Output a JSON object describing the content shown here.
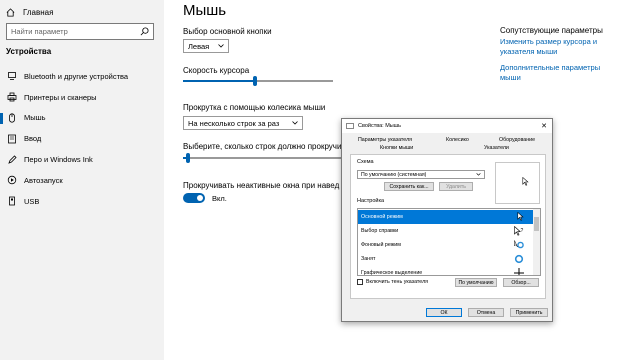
{
  "sidebar": {
    "home_label": "Главная",
    "search_placeholder": "Найти параметр",
    "section_label": "Устройства",
    "items": [
      {
        "label": "Bluetooth и другие устройства",
        "icon": "bluetooth-icon"
      },
      {
        "label": "Принтеры и сканеры",
        "icon": "printer-icon"
      },
      {
        "label": "Мышь",
        "icon": "mouse-icon",
        "active": true
      },
      {
        "label": "Ввод",
        "icon": "keyboard-icon"
      },
      {
        "label": "Перо и Windows Ink",
        "icon": "pen-icon"
      },
      {
        "label": "Автозапуск",
        "icon": "autoplay-icon"
      },
      {
        "label": "USB",
        "icon": "usb-icon"
      }
    ]
  },
  "main": {
    "title": "Мышь",
    "primary_button_label": "Выбор основной кнопки",
    "primary_button_value": "Левая",
    "cursor_speed_label": "Скорость курсора",
    "cursor_speed_fraction": 0.48,
    "scroll_label": "Прокрутка с помощью колесика мыши",
    "scroll_value": "На несколько строк за раз",
    "lines_label": "Выберите, сколько строк должно прокручи",
    "lines_fraction": 0.02,
    "inactive_scroll_label": "Прокручивать неактивные окна при навед",
    "toggle_state": "Вкл."
  },
  "related": {
    "title": "Сопутствующие параметры",
    "links": [
      "Изменить размер курсора и указателя мыши",
      "Дополнительные параметры мыши"
    ]
  },
  "dialog": {
    "title": "Свойства: Мышь",
    "tabs_row1": [
      "Параметры указателя",
      "Колесико",
      "Оборудование"
    ],
    "tabs_row2": [
      "Кнопки мыши",
      "Указатели"
    ],
    "scheme_label": "Схема",
    "scheme_value": "По умолчанию (системная)",
    "save_as_label": "Сохранить как...",
    "delete_label": "Удалить",
    "customize_label": "Настройка",
    "pointer_list": [
      {
        "label": "Основной режим",
        "icon": "arrow-cursor-icon",
        "selected": true
      },
      {
        "label": "Выбор справки",
        "icon": "help-cursor-icon"
      },
      {
        "label": "Фоновый режим",
        "icon": "working-cursor-icon"
      },
      {
        "label": "Занят",
        "icon": "busy-cursor-icon"
      },
      {
        "label": "Графическое выделение",
        "icon": "crosshair-cursor-icon"
      }
    ],
    "shadow_label": "Включить тень указателя",
    "default_label": "По умолчанию",
    "browse_label": "Обзор...",
    "ok_label": "ОК",
    "cancel_label": "Отмена",
    "apply_label": "Применить"
  },
  "colors": {
    "accent": "#0063b1",
    "selection": "#0078d7"
  }
}
